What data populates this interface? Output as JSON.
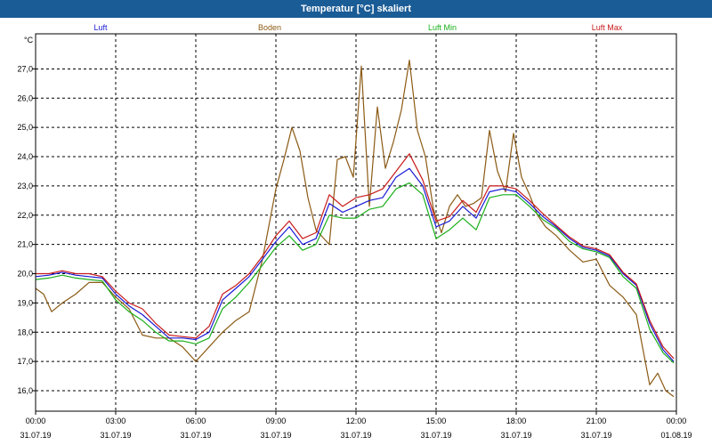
{
  "window": {
    "title": "Temperatur [°C] skaliert"
  },
  "chart_data": {
    "type": "line",
    "title": "Temperatur [°C] skaliert",
    "ylabel": "°C",
    "xlabel": "",
    "ylim": [
      15.3,
      28.2
    ],
    "xlim": [
      0,
      24
    ],
    "grid": true,
    "legend_position": "top",
    "y_ticks": [
      "16,0",
      "17,0",
      "18,0",
      "19,0",
      "20,0",
      "21,0",
      "22,0",
      "23,0",
      "24,0",
      "25,0",
      "26,0",
      "27,0"
    ],
    "x_ticks": [
      {
        "time": "00:00",
        "date": "31.07.19"
      },
      {
        "time": "03:00",
        "date": "31.07.19"
      },
      {
        "time": "06:00",
        "date": "31.07.19"
      },
      {
        "time": "09:00",
        "date": "31.07.19"
      },
      {
        "time": "12:00",
        "date": "31.07.19"
      },
      {
        "time": "15:00",
        "date": "31.07.19"
      },
      {
        "time": "18:00",
        "date": "31.07.19"
      },
      {
        "time": "21:00",
        "date": "31.07.19"
      },
      {
        "time": "00:00",
        "date": "01.08.19"
      }
    ],
    "series": [
      {
        "name": "Luft",
        "color": "#1a1ad6",
        "x": [
          0,
          0.5,
          1,
          1.5,
          2,
          2.5,
          3,
          3.5,
          4,
          4.5,
          5,
          5.5,
          6,
          6.5,
          7,
          7.5,
          8,
          8.5,
          9,
          9.5,
          10,
          10.5,
          11,
          11.5,
          12,
          12.5,
          13,
          13.5,
          14,
          14.5,
          15,
          15.5,
          16,
          16.5,
          17,
          17.5,
          18,
          18.5,
          19,
          19.5,
          20,
          20.5,
          21,
          21.5,
          22,
          22.5,
          23,
          23.5,
          23.9
        ],
        "y": [
          19.9,
          19.95,
          20.05,
          19.95,
          19.9,
          19.85,
          19.3,
          18.9,
          18.6,
          18.2,
          17.8,
          17.8,
          17.75,
          18.0,
          19.1,
          19.5,
          19.9,
          20.5,
          21.1,
          21.6,
          21.0,
          21.2,
          22.4,
          22.1,
          22.3,
          22.5,
          22.6,
          23.3,
          23.6,
          23.0,
          21.6,
          21.8,
          22.3,
          21.9,
          22.8,
          22.9,
          22.8,
          22.4,
          21.95,
          21.6,
          21.2,
          20.9,
          20.8,
          20.6,
          20.0,
          19.6,
          18.3,
          17.4,
          17.0
        ]
      },
      {
        "name": "Boden",
        "color": "#8b5a14",
        "x": [
          0,
          0.3,
          0.6,
          1,
          1.5,
          2,
          2.5,
          3,
          3.5,
          4,
          4.5,
          5,
          5.5,
          6,
          6.5,
          7,
          7.5,
          8,
          8.5,
          9,
          9.3,
          9.6,
          9.9,
          10.2,
          10.5,
          10.8,
          11,
          11.3,
          11.6,
          11.9,
          12.2,
          12.5,
          12.8,
          13.1,
          13.4,
          13.7,
          14,
          14.3,
          14.6,
          14.9,
          15.2,
          15.5,
          15.8,
          16.1,
          16.4,
          16.7,
          17,
          17.3,
          17.6,
          17.9,
          18.2,
          18.5,
          18.8,
          19.1,
          19.5,
          20,
          20.5,
          21,
          21.5,
          22,
          22.5,
          23,
          23.3,
          23.6,
          23.9
        ],
        "y": [
          19.5,
          19.3,
          18.7,
          19.0,
          19.3,
          19.7,
          19.7,
          19.2,
          18.8,
          17.9,
          17.8,
          17.8,
          17.5,
          17.0,
          17.5,
          18.0,
          18.4,
          18.7,
          20.5,
          22.9,
          23.9,
          25.0,
          24.2,
          22.6,
          21.5,
          21.2,
          21.0,
          23.9,
          24.0,
          23.3,
          27.1,
          22.3,
          25.7,
          23.6,
          24.5,
          25.6,
          27.3,
          24.9,
          24.0,
          22.2,
          21.4,
          22.3,
          22.7,
          22.3,
          22.4,
          22.6,
          24.9,
          23.5,
          22.8,
          24.8,
          23.3,
          22.7,
          22.0,
          21.6,
          21.3,
          20.8,
          20.4,
          20.5,
          19.6,
          19.2,
          18.6,
          16.2,
          16.6,
          16.0,
          15.8
        ]
      },
      {
        "name": "Luft Min",
        "color": "#1aaf1a",
        "x": [
          0,
          0.5,
          1,
          1.5,
          2,
          2.5,
          3,
          3.5,
          4,
          4.5,
          5,
          5.5,
          6,
          6.5,
          7,
          7.5,
          8,
          8.5,
          9,
          9.5,
          10,
          10.5,
          11,
          11.5,
          12,
          12.5,
          13,
          13.5,
          14,
          14.5,
          15,
          15.5,
          16,
          16.5,
          17,
          17.5,
          18,
          18.5,
          19,
          19.5,
          20,
          20.5,
          21,
          21.5,
          22,
          22.5,
          23,
          23.5,
          23.9
        ],
        "y": [
          19.8,
          19.85,
          19.95,
          19.85,
          19.8,
          19.75,
          19.1,
          18.7,
          18.4,
          18.0,
          17.7,
          17.7,
          17.6,
          17.8,
          18.8,
          19.2,
          19.7,
          20.3,
          20.9,
          21.3,
          20.8,
          21.0,
          22.0,
          21.9,
          21.9,
          22.2,
          22.3,
          22.9,
          23.1,
          22.7,
          21.2,
          21.5,
          21.9,
          21.5,
          22.6,
          22.7,
          22.7,
          22.3,
          21.85,
          21.55,
          21.1,
          20.85,
          20.75,
          20.55,
          19.9,
          19.5,
          18.1,
          17.3,
          16.95
        ]
      },
      {
        "name": "Luft Max",
        "color": "#c81a1a",
        "x": [
          0,
          0.5,
          1,
          1.5,
          2,
          2.5,
          3,
          3.5,
          4,
          4.5,
          5,
          5.5,
          6,
          6.5,
          7,
          7.5,
          8,
          8.5,
          9,
          9.5,
          10,
          10.5,
          11,
          11.5,
          12,
          12.5,
          13,
          13.5,
          14,
          14.5,
          15,
          15.5,
          16,
          16.5,
          17,
          17.5,
          18,
          18.5,
          19,
          19.5,
          20,
          20.5,
          21,
          21.5,
          22,
          22.5,
          23,
          23.5,
          23.9
        ],
        "y": [
          20.0,
          20.0,
          20.1,
          20.0,
          20.0,
          19.9,
          19.4,
          19.0,
          18.8,
          18.3,
          17.9,
          17.85,
          17.8,
          18.2,
          19.3,
          19.6,
          20.0,
          20.6,
          21.3,
          21.8,
          21.2,
          21.4,
          22.7,
          22.3,
          22.6,
          22.7,
          22.9,
          23.5,
          24.1,
          23.2,
          21.8,
          21.95,
          22.5,
          22.1,
          23.0,
          23.0,
          22.9,
          22.5,
          22.05,
          21.65,
          21.25,
          20.95,
          20.85,
          20.65,
          20.05,
          19.65,
          18.4,
          17.5,
          17.1
        ]
      }
    ]
  }
}
